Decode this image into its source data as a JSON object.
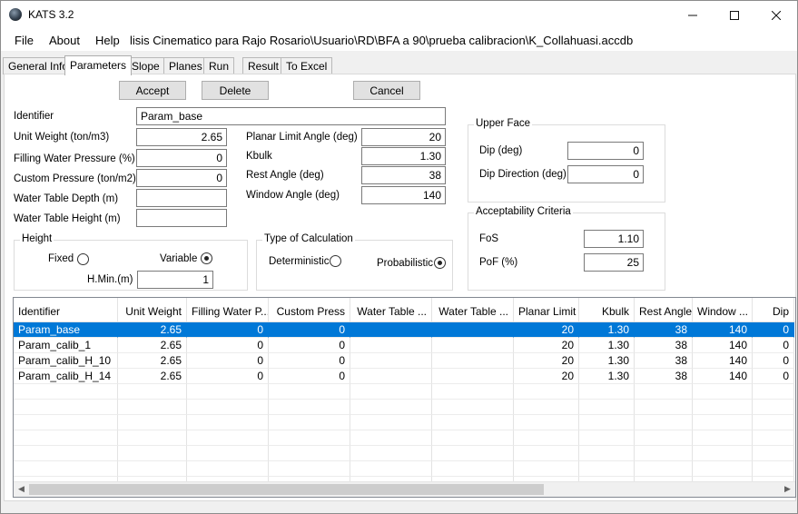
{
  "window": {
    "title": "KATS 3.2"
  },
  "menu": {
    "file": "File",
    "about": "About",
    "help": "Help",
    "path": "lisis Cinematico para Rajo Rosario\\Usuario\\RD\\BFA a 90\\prueba calibracion\\K_Collahuasi.accdb"
  },
  "tabs": [
    "General Info",
    "Parameters",
    "Slope",
    "Planes",
    "Run",
    "Result",
    "To Excel"
  ],
  "active_tab": "Parameters",
  "buttons": {
    "accept": "Accept",
    "delete": "Delete",
    "cancel": "Cancel"
  },
  "form": {
    "identifier_label": "Identifier",
    "identifier_value": "Param_base",
    "unit_weight_label": "Unit Weight (ton/m3)",
    "unit_weight_value": "2.65",
    "filling_label": "Filling Water Pressure (%)",
    "filling_value": "0",
    "custom_label": "Custom Pressure (ton/m2)",
    "custom_value": "0",
    "wt_depth_label": "Water Table Depth (m)",
    "wt_depth_value": "",
    "wt_height_label": "Water Table Height (m)",
    "wt_height_value": "",
    "planar_label": "Planar Limit Angle (deg)",
    "planar_value": "20",
    "kbulk_label": "Kbulk",
    "kbulk_value": "1.30",
    "rest_label": "Rest Angle (deg)",
    "rest_value": "38",
    "window_label": "Window Angle (deg)",
    "window_value": "140"
  },
  "height_group": {
    "title": "Height",
    "fixed": "Fixed",
    "variable": "Variable",
    "hmin_label": "H.Min.(m)",
    "hmin_value": "1"
  },
  "calc_group": {
    "title": "Type of Calculation",
    "deterministic": "Deterministic",
    "probabilistic": "Probabilistic"
  },
  "upper_face": {
    "title": "Upper Face",
    "dip_label": "Dip (deg)",
    "dip_value": "0",
    "dipdir_label": "Dip Direction (deg)",
    "dipdir_value": "0"
  },
  "acceptability": {
    "title": "Acceptability Criteria",
    "fos_label": "FoS",
    "fos_value": "1.10",
    "pof_label": "PoF (%)",
    "pof_value": "25"
  },
  "grid": {
    "columns": [
      "Identifier",
      "Unit Weight",
      "Filling Water P...",
      "Custom Press",
      "Water Table ...",
      "Water Table ...",
      "Planar Limit",
      "Kbulk",
      "Rest Angle",
      "Window ...",
      "Dip"
    ],
    "rows": [
      [
        "Param_base",
        "2.65",
        "0",
        "0",
        "",
        "",
        "20",
        "1.30",
        "38",
        "140",
        "0"
      ],
      [
        "Param_calib_1",
        "2.65",
        "0",
        "0",
        "",
        "",
        "20",
        "1.30",
        "38",
        "140",
        "0"
      ],
      [
        "Param_calib_H_10",
        "2.65",
        "0",
        "0",
        "",
        "",
        "20",
        "1.30",
        "38",
        "140",
        "0"
      ],
      [
        "Param_calib_H_14",
        "2.65",
        "0",
        "0",
        "",
        "",
        "20",
        "1.30",
        "38",
        "140",
        "0"
      ]
    ]
  },
  "colors": {
    "selection": "#0078d7",
    "window_bg": "#f0f0f0"
  }
}
